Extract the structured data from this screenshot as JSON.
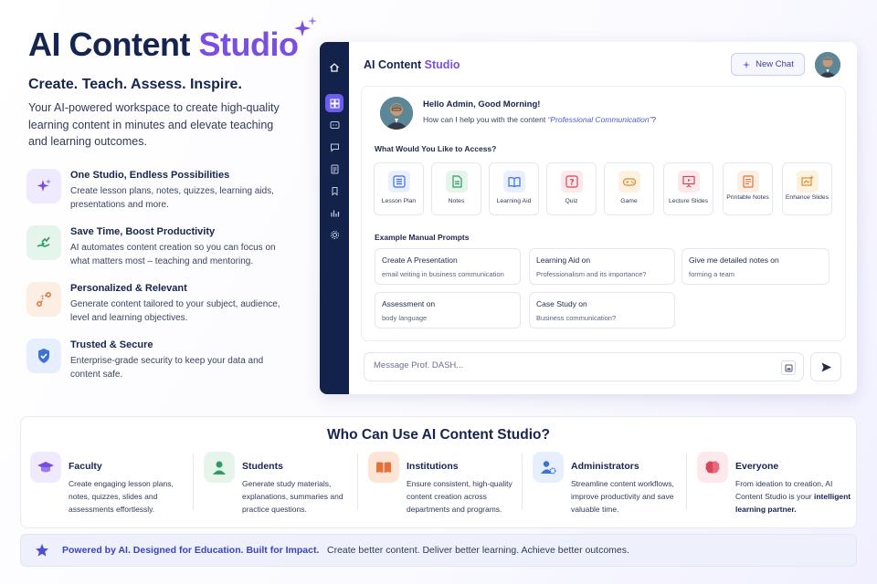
{
  "hero": {
    "title_main": "AI Content",
    "title_accent": "Studio",
    "tagline": "Create. Teach. Assess. Inspire.",
    "intro": "Your AI-powered workspace to create high-quality learning content in minutes and elevate teaching and learning outcomes."
  },
  "features": [
    {
      "title": "One Studio, Endless Possibilities",
      "desc": "Create lesson plans, notes, quizzes, learning aids, presentations and more.",
      "icon": "sparkle-icon",
      "color": "#7a4ee0"
    },
    {
      "title": "Save Time, Boost Productivity",
      "desc": "AI automates content creation so you can focus on what matters most – teaching and mentoring.",
      "icon": "hand-growth-icon",
      "color": "#2f9a63"
    },
    {
      "title": "Personalized & Relevant",
      "desc": "Generate content tailored to your subject, audience, level and learning objectives.",
      "icon": "target-path-icon",
      "color": "#e0723a"
    },
    {
      "title": "Trusted & Secure",
      "desc": "Enterprise-grade security to keep your data and content safe.",
      "icon": "shield-check-icon",
      "color": "#3a72d8"
    }
  ],
  "app": {
    "title_main": "AI Content",
    "title_accent": "Studio",
    "new_chat_label": "New Chat",
    "greeting": "Hello Admin, Good Morning!",
    "prompt_prefix": "How can I help you with the content ",
    "prompt_topic": "“Professional Communication”",
    "prompt_suffix": "?",
    "access_heading": "What Would You Like to Access?",
    "tools": [
      {
        "label": "Lesson Plan",
        "icon": "list-icon",
        "color": "#3a72d8"
      },
      {
        "label": "Notes",
        "icon": "note-icon",
        "color": "#2f9a63"
      },
      {
        "label": "Learning Aid",
        "icon": "book-icon",
        "color": "#3a72d8"
      },
      {
        "label": "Quiz",
        "icon": "question-icon",
        "color": "#d8465a"
      },
      {
        "label": "Game",
        "icon": "gamepad-icon",
        "color": "#e08a2a"
      },
      {
        "label": "Lecture Slides",
        "icon": "presentation-icon",
        "color": "#d8465a"
      },
      {
        "label": "Printable Notes",
        "icon": "document-icon",
        "color": "#e0723a"
      },
      {
        "label": "Enhance Slides",
        "icon": "magic-slides-icon",
        "color": "#e08a2a"
      }
    ],
    "prompts_heading": "Example Manual Prompts",
    "prompts": [
      {
        "title": "Create A Presentation",
        "sub": "email writing in business communication"
      },
      {
        "title": "Learning Aid on",
        "sub": "Professionalism and its importance?"
      },
      {
        "title": "Give me detailed notes on",
        "sub": "forming a team"
      },
      {
        "title": "Assessment on",
        "sub": "body language"
      },
      {
        "title": "Case Study on",
        "sub": "Business communication?"
      }
    ],
    "message_placeholder": "Message Prof. DASH...",
    "sidebar": [
      "home-icon",
      "dashboard-icon",
      "chat-icon",
      "message-icon",
      "document-icon",
      "bookmark-icon",
      "chart-icon",
      "settings-icon"
    ]
  },
  "who": {
    "title": "Who Can Use AI Content Studio?",
    "audiences": [
      {
        "title": "Faculty",
        "desc": "Create engaging lesson plans, notes, quizzes, slides and assessments effortlessly.",
        "icon": "graduation-cap-icon",
        "color": "#7a4ee0"
      },
      {
        "title": "Students",
        "desc": "Generate study materials, explanations, summaries and practice questions.",
        "icon": "student-icon",
        "color": "#2f9a63"
      },
      {
        "title": "Institutions",
        "desc": "Ensure consistent, high-quality content creation across departments and programs.",
        "icon": "open-book-icon",
        "color": "#e0723a"
      },
      {
        "title": "Administrators",
        "desc": "Streamline content workflows, improve productivity and save valuable time.",
        "icon": "admin-icon",
        "color": "#3a72d8"
      },
      {
        "title": "Everyone",
        "desc_prefix": "From ideation to creation, AI Content Studio is your ",
        "desc_bold": "intelligent learning partner.",
        "icon": "brain-icon",
        "color": "#d8465a"
      }
    ]
  },
  "footer": {
    "bold": "Powered by AI. Designed for Education. Built for Impact.",
    "rest": "Create better content. Deliver better learning. Achieve better outcomes."
  }
}
